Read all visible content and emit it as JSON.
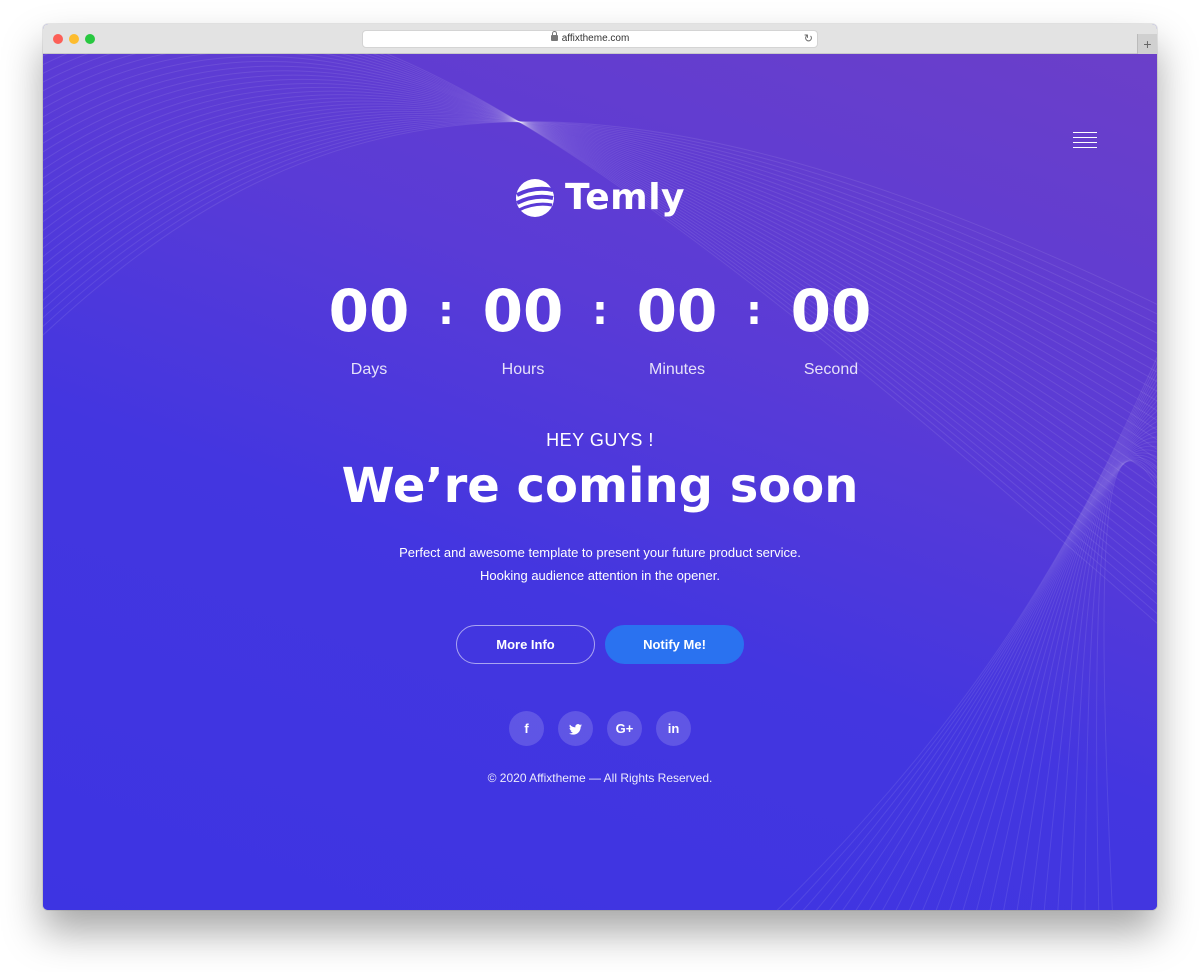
{
  "browser": {
    "url": "affixtheme.com",
    "new_tab_symbol": "+",
    "reload_symbol": "↻"
  },
  "brand": {
    "name": "Temly",
    "logo_icon": "sphere-logo-icon"
  },
  "menu": {
    "icon": "hamburger-menu-icon"
  },
  "countdown": [
    {
      "value": "00",
      "label": "Days"
    },
    {
      "value": "00",
      "label": "Hours"
    },
    {
      "value": "00",
      "label": "Minutes"
    },
    {
      "value": "00",
      "label": "Second"
    }
  ],
  "separator": ":",
  "hero": {
    "eyebrow": "HEY GUYS !",
    "headline": "We’re coming soon",
    "line1": "Perfect and awesome template to present your future product service.",
    "line2": "Hooking audience attention in the opener."
  },
  "buttons": {
    "more_info": "More Info",
    "notify": "Notify Me!"
  },
  "social": [
    {
      "name": "facebook-icon",
      "glyph": "f"
    },
    {
      "name": "twitter-icon",
      "glyph": "t"
    },
    {
      "name": "google-plus-icon",
      "glyph": "G+"
    },
    {
      "name": "linkedin-icon",
      "glyph": "in"
    }
  ],
  "footer": {
    "copyright": "© 2020 Affixtheme — All Rights Reserved."
  },
  "colors": {
    "background_top": "#6b3fc9",
    "background_bottom": "#3d34e2",
    "accent_button": "#2a72f0"
  }
}
